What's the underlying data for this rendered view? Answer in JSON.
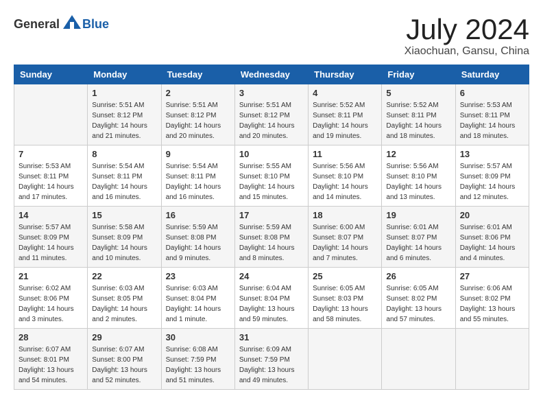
{
  "header": {
    "logo_general": "General",
    "logo_blue": "Blue",
    "title": "July 2024",
    "location": "Xiaochuan, Gansu, China"
  },
  "days_of_week": [
    "Sunday",
    "Monday",
    "Tuesday",
    "Wednesday",
    "Thursday",
    "Friday",
    "Saturday"
  ],
  "weeks": [
    [
      {
        "day": "",
        "info": ""
      },
      {
        "day": "1",
        "info": "Sunrise: 5:51 AM\nSunset: 8:12 PM\nDaylight: 14 hours\nand 21 minutes."
      },
      {
        "day": "2",
        "info": "Sunrise: 5:51 AM\nSunset: 8:12 PM\nDaylight: 14 hours\nand 20 minutes."
      },
      {
        "day": "3",
        "info": "Sunrise: 5:51 AM\nSunset: 8:12 PM\nDaylight: 14 hours\nand 20 minutes."
      },
      {
        "day": "4",
        "info": "Sunrise: 5:52 AM\nSunset: 8:11 PM\nDaylight: 14 hours\nand 19 minutes."
      },
      {
        "day": "5",
        "info": "Sunrise: 5:52 AM\nSunset: 8:11 PM\nDaylight: 14 hours\nand 18 minutes."
      },
      {
        "day": "6",
        "info": "Sunrise: 5:53 AM\nSunset: 8:11 PM\nDaylight: 14 hours\nand 18 minutes."
      }
    ],
    [
      {
        "day": "7",
        "info": "Sunrise: 5:53 AM\nSunset: 8:11 PM\nDaylight: 14 hours\nand 17 minutes."
      },
      {
        "day": "8",
        "info": "Sunrise: 5:54 AM\nSunset: 8:11 PM\nDaylight: 14 hours\nand 16 minutes."
      },
      {
        "day": "9",
        "info": "Sunrise: 5:54 AM\nSunset: 8:11 PM\nDaylight: 14 hours\nand 16 minutes."
      },
      {
        "day": "10",
        "info": "Sunrise: 5:55 AM\nSunset: 8:10 PM\nDaylight: 14 hours\nand 15 minutes."
      },
      {
        "day": "11",
        "info": "Sunrise: 5:56 AM\nSunset: 8:10 PM\nDaylight: 14 hours\nand 14 minutes."
      },
      {
        "day": "12",
        "info": "Sunrise: 5:56 AM\nSunset: 8:10 PM\nDaylight: 14 hours\nand 13 minutes."
      },
      {
        "day": "13",
        "info": "Sunrise: 5:57 AM\nSunset: 8:09 PM\nDaylight: 14 hours\nand 12 minutes."
      }
    ],
    [
      {
        "day": "14",
        "info": "Sunrise: 5:57 AM\nSunset: 8:09 PM\nDaylight: 14 hours\nand 11 minutes."
      },
      {
        "day": "15",
        "info": "Sunrise: 5:58 AM\nSunset: 8:09 PM\nDaylight: 14 hours\nand 10 minutes."
      },
      {
        "day": "16",
        "info": "Sunrise: 5:59 AM\nSunset: 8:08 PM\nDaylight: 14 hours\nand 9 minutes."
      },
      {
        "day": "17",
        "info": "Sunrise: 5:59 AM\nSunset: 8:08 PM\nDaylight: 14 hours\nand 8 minutes."
      },
      {
        "day": "18",
        "info": "Sunrise: 6:00 AM\nSunset: 8:07 PM\nDaylight: 14 hours\nand 7 minutes."
      },
      {
        "day": "19",
        "info": "Sunrise: 6:01 AM\nSunset: 8:07 PM\nDaylight: 14 hours\nand 6 minutes."
      },
      {
        "day": "20",
        "info": "Sunrise: 6:01 AM\nSunset: 8:06 PM\nDaylight: 14 hours\nand 4 minutes."
      }
    ],
    [
      {
        "day": "21",
        "info": "Sunrise: 6:02 AM\nSunset: 8:06 PM\nDaylight: 14 hours\nand 3 minutes."
      },
      {
        "day": "22",
        "info": "Sunrise: 6:03 AM\nSunset: 8:05 PM\nDaylight: 14 hours\nand 2 minutes."
      },
      {
        "day": "23",
        "info": "Sunrise: 6:03 AM\nSunset: 8:04 PM\nDaylight: 14 hours\nand 1 minute."
      },
      {
        "day": "24",
        "info": "Sunrise: 6:04 AM\nSunset: 8:04 PM\nDaylight: 13 hours\nand 59 minutes."
      },
      {
        "day": "25",
        "info": "Sunrise: 6:05 AM\nSunset: 8:03 PM\nDaylight: 13 hours\nand 58 minutes."
      },
      {
        "day": "26",
        "info": "Sunrise: 6:05 AM\nSunset: 8:02 PM\nDaylight: 13 hours\nand 57 minutes."
      },
      {
        "day": "27",
        "info": "Sunrise: 6:06 AM\nSunset: 8:02 PM\nDaylight: 13 hours\nand 55 minutes."
      }
    ],
    [
      {
        "day": "28",
        "info": "Sunrise: 6:07 AM\nSunset: 8:01 PM\nDaylight: 13 hours\nand 54 minutes."
      },
      {
        "day": "29",
        "info": "Sunrise: 6:07 AM\nSunset: 8:00 PM\nDaylight: 13 hours\nand 52 minutes."
      },
      {
        "day": "30",
        "info": "Sunrise: 6:08 AM\nSunset: 7:59 PM\nDaylight: 13 hours\nand 51 minutes."
      },
      {
        "day": "31",
        "info": "Sunrise: 6:09 AM\nSunset: 7:59 PM\nDaylight: 13 hours\nand 49 minutes."
      },
      {
        "day": "",
        "info": ""
      },
      {
        "day": "",
        "info": ""
      },
      {
        "day": "",
        "info": ""
      }
    ]
  ]
}
